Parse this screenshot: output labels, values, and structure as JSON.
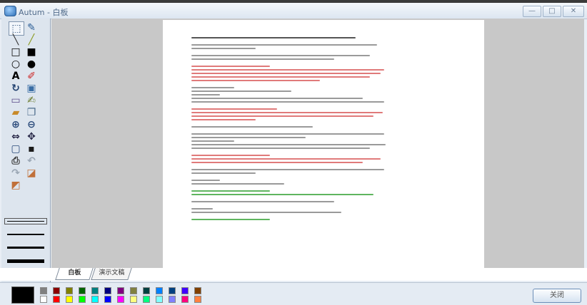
{
  "window": {
    "title": "Autum - 白板",
    "minimize_label": "—",
    "maximize_label": "□",
    "close_label": "✕"
  },
  "tools": [
    {
      "name": "select-tool-icon",
      "glyph": "⬚",
      "color": "#2b4f7a",
      "selected": true
    },
    {
      "name": "pencil-tool-icon",
      "glyph": "✎",
      "color": "#2a5d96"
    },
    {
      "name": "line-tool-icon",
      "glyph": "╲",
      "color": "#333333"
    },
    {
      "name": "highlighter-tool-icon",
      "glyph": "╱",
      "color": "#8a9a20"
    },
    {
      "name": "rectangle-outline-icon",
      "glyph": "□",
      "color": "#000000"
    },
    {
      "name": "rectangle-filled-icon",
      "glyph": "■",
      "color": "#000000"
    },
    {
      "name": "ellipse-outline-icon",
      "glyph": "○",
      "color": "#000000"
    },
    {
      "name": "ellipse-filled-icon",
      "glyph": "●",
      "color": "#000000"
    },
    {
      "name": "text-tool-icon",
      "glyph": "A",
      "color": "#000000"
    },
    {
      "name": "eraser-tool-icon",
      "glyph": "✐",
      "color": "#cc2222"
    },
    {
      "name": "rotate-icon",
      "glyph": "↻",
      "color": "#1f3f6e"
    },
    {
      "name": "window-capture-icon",
      "glyph": "▣",
      "color": "#3a6ea5"
    },
    {
      "name": "screen-capture-icon",
      "glyph": "▭",
      "color": "#5a4a8a"
    },
    {
      "name": "edit-image-icon",
      "glyph": "✍",
      "color": "#6a7a2a"
    },
    {
      "name": "open-folder-icon",
      "glyph": "▰",
      "color": "#c88a2a"
    },
    {
      "name": "copy-image-icon",
      "glyph": "❐",
      "color": "#4a6a8a"
    },
    {
      "name": "zoom-in-icon",
      "glyph": "⊕",
      "color": "#2a4a7a"
    },
    {
      "name": "zoom-out-icon",
      "glyph": "⊖",
      "color": "#2a4a7a"
    },
    {
      "name": "fit-width-icon",
      "glyph": "⇔",
      "color": "#2a2a4a"
    },
    {
      "name": "move-icon",
      "glyph": "✥",
      "color": "#2a2a4a"
    },
    {
      "name": "fullscreen-icon",
      "glyph": "▢",
      "color": "#2a4a7a"
    },
    {
      "name": "save-icon",
      "glyph": "▪",
      "color": "#1a1a1a"
    },
    {
      "name": "print-icon",
      "glyph": "⎙",
      "color": "#3a3a3a"
    },
    {
      "name": "undo-icon",
      "glyph": "↶",
      "color": "#9aa6b4"
    },
    {
      "name": "redo-icon",
      "glyph": "↷",
      "color": "#9aa6b4"
    },
    {
      "name": "paste-icon",
      "glyph": "◪",
      "color": "#c0703a"
    },
    {
      "name": "cut-icon",
      "glyph": "◩",
      "color": "#c0703a"
    }
  ],
  "line_widths": [
    1,
    2,
    3,
    5
  ],
  "tabs": [
    {
      "label": "白板",
      "active": true
    },
    {
      "label": "演示文稿",
      "active": false
    }
  ],
  "palette": {
    "primary_color": "#000000",
    "top_row": [
      "#808080",
      "#8b0000",
      "#808000",
      "#006400",
      "#008080",
      "#000080",
      "#800080",
      "#808040",
      "#004040",
      "#0080ff",
      "#004080",
      "#4000ff",
      "#804000"
    ],
    "bottom_row": [
      "#ffffff",
      "#ff0000",
      "#ffff00",
      "#00ff00",
      "#00ffff",
      "#0000ff",
      "#ff00ff",
      "#ffff80",
      "#00ff80",
      "#80ffff",
      "#8080ff",
      "#ff0080",
      "#ff8040"
    ]
  },
  "close_button_label": "关闭"
}
